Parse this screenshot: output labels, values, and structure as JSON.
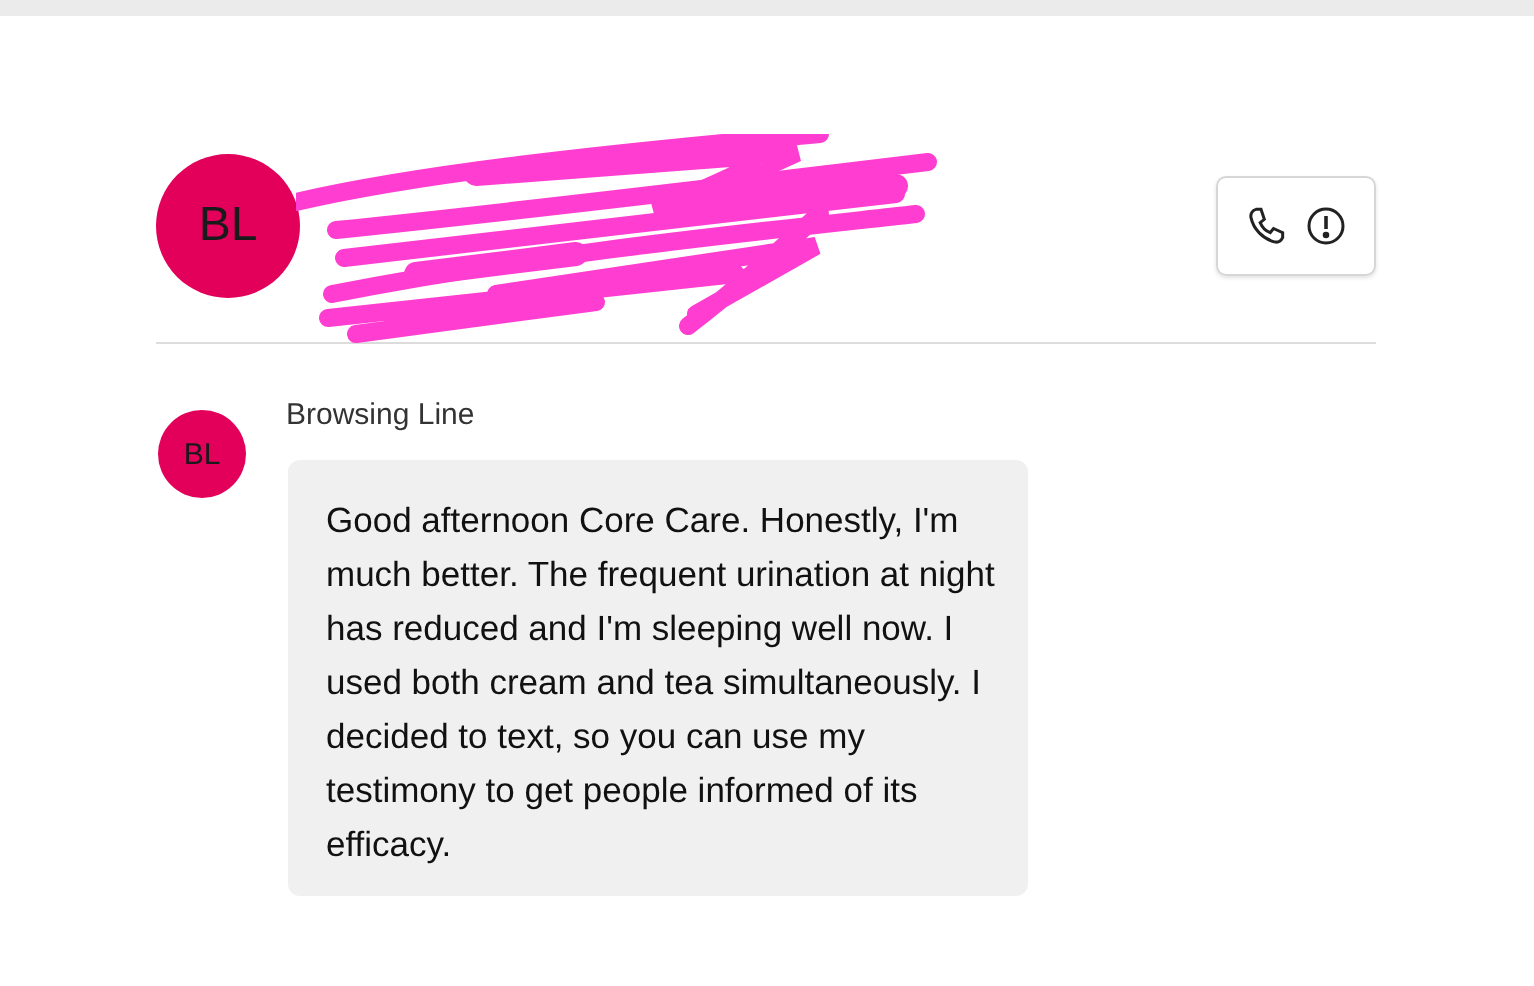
{
  "header": {
    "avatar": "BL",
    "redacted": true
  },
  "messages": [
    {
      "avatar": "BL",
      "sender": "Browsing Line",
      "text": "Good afternoon Core Care. Honestly, I'm much better. The frequent urination at night has reduced and I'm sleeping well now. I used both cream and tea simultaneously.  I decided to text, so you can use my testimony to get people informed of its efficacy."
    }
  ]
}
